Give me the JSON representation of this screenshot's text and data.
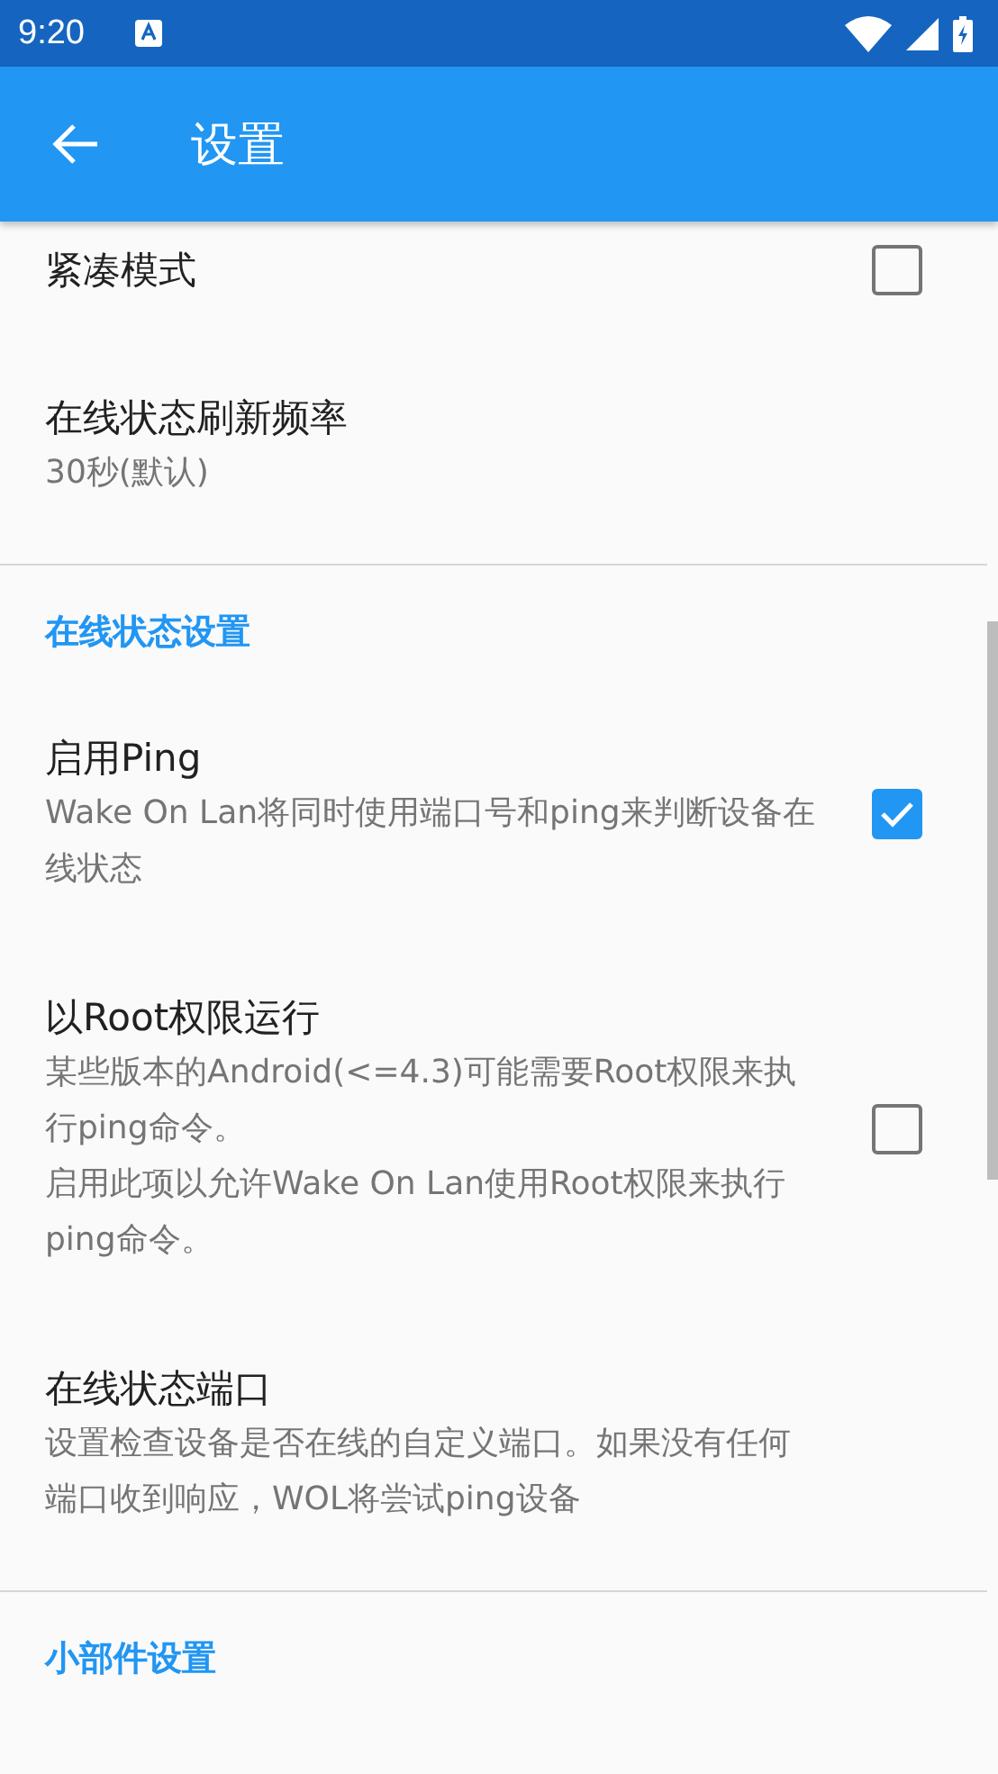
{
  "status_bar": {
    "time": "9:20"
  },
  "app_bar": {
    "title": "设置"
  },
  "items": [
    {
      "kind": "setting",
      "title": "紧凑模式",
      "checked": false
    },
    {
      "kind": "setting",
      "title": "在线状态刷新频率",
      "summary": "30秒(默认)"
    },
    {
      "kind": "divider"
    },
    {
      "kind": "header",
      "title": "在线状态设置"
    },
    {
      "kind": "setting",
      "title": "启用Ping",
      "summary": "Wake On Lan将同时使用端口号和ping来判断设备在线状态",
      "checked": true
    },
    {
      "kind": "setting",
      "title": "以Root权限运行",
      "summary": "某些版本的Android(<=4.3)可能需要Root权限来执行ping命令。",
      "summary_2": "启用此项以允许Wake On Lan使用Root权限来执行ping命令。",
      "checked": false
    },
    {
      "kind": "setting",
      "title": "在线状态端口",
      "summary": "设置检查设备是否在线的自定义端口。如果没有任何端口收到响应，WOL将尝试ping设备"
    },
    {
      "kind": "divider"
    },
    {
      "kind": "header",
      "title": "小部件设置"
    }
  ]
}
